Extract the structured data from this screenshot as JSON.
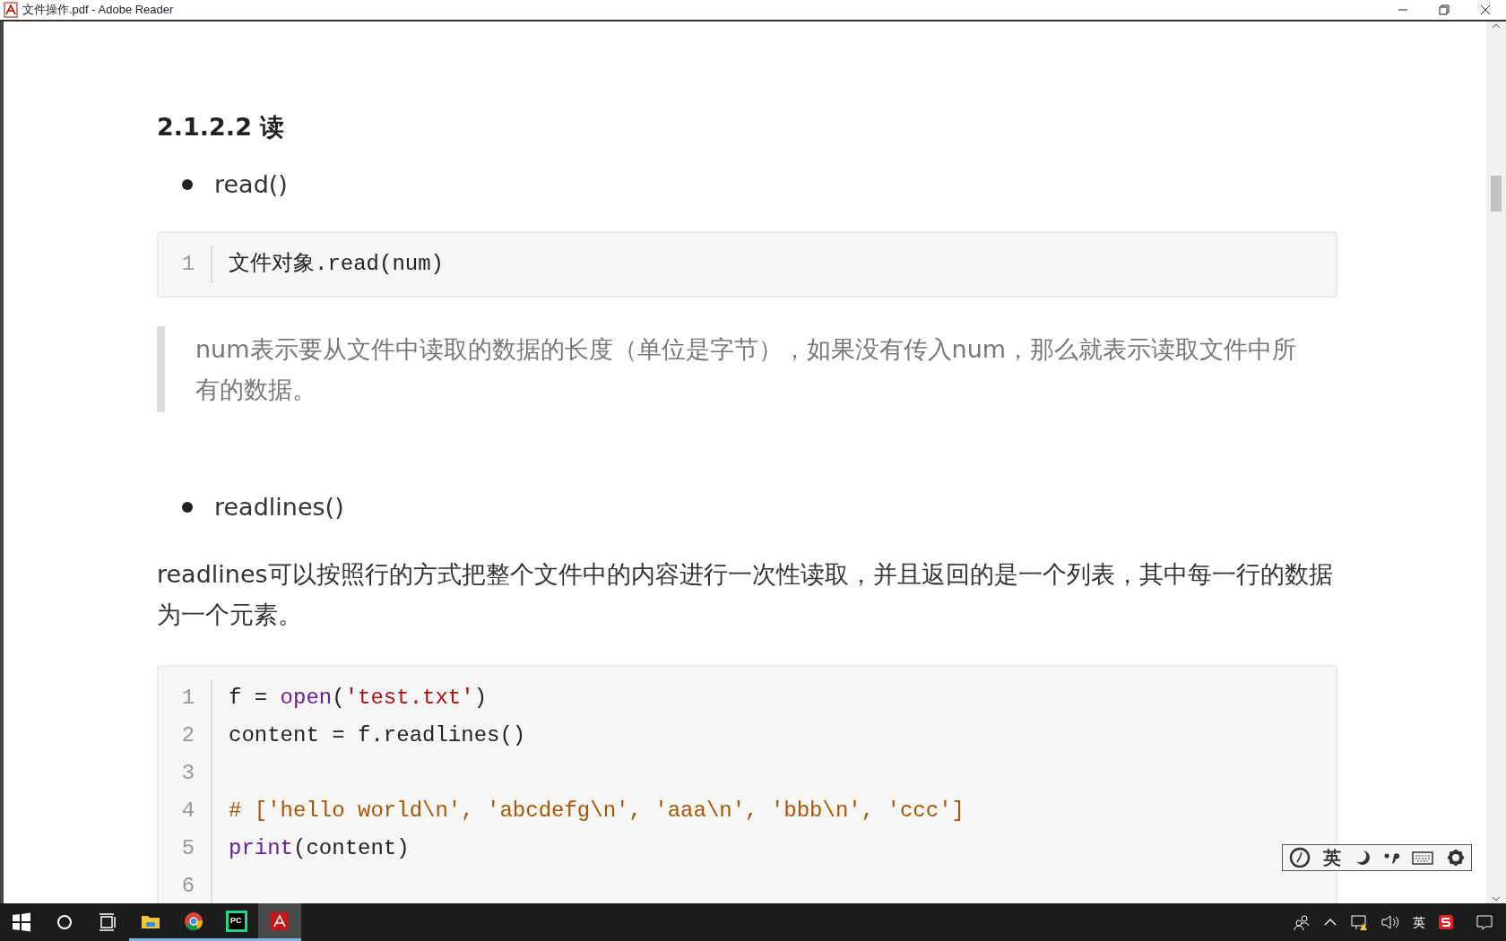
{
  "window": {
    "title": "文件操作.pdf - Adobe Reader"
  },
  "document": [
    {
      "kind": "heading",
      "text": "2.1.2.2 读"
    },
    {
      "kind": "bullet",
      "text": "read()"
    },
    {
      "kind": "code",
      "lines": [
        {
          "number": "1",
          "tokens": [
            {
              "kind": "plain",
              "text": "文件对象.read(num)"
            }
          ]
        }
      ]
    },
    {
      "kind": "quote",
      "text": "num表示要从文件中读取的数据的长度（单位是字节），如果没有传入num，那么就表示读取文件中所有的数据。"
    },
    {
      "kind": "bullet",
      "text": "readlines()"
    },
    {
      "kind": "paragraph",
      "text": "readlines可以按照行的方式把整个文件中的内容进行一次性读取，并且返回的是一个列表，其中每一行的数据为一个元素。"
    },
    {
      "kind": "code",
      "lines": [
        {
          "number": "1",
          "tokens": [
            {
              "kind": "plain",
              "text": "f = "
            },
            {
              "kind": "builtin",
              "text": "open"
            },
            {
              "kind": "plain",
              "text": "("
            },
            {
              "kind": "string",
              "text": "'test.txt'"
            },
            {
              "kind": "plain",
              "text": ")"
            }
          ]
        },
        {
          "number": "2",
          "tokens": [
            {
              "kind": "plain",
              "text": "content = f.readlines()"
            }
          ]
        },
        {
          "number": "3"
        },
        {
          "number": "4",
          "tokens": [
            {
              "kind": "comment",
              "text": "# ['hello world\\n', 'abcdefg\\n', 'aaa\\n', 'bbb\\n', 'ccc']"
            }
          ]
        },
        {
          "number": "5",
          "tokens": [
            {
              "kind": "builtin",
              "text": "print"
            },
            {
              "kind": "plain",
              "text": "(content)"
            }
          ]
        },
        {
          "number": "6"
        }
      ]
    }
  ],
  "ime_toolbar": {
    "mode": "英"
  },
  "taskbar": {
    "apps": [
      {
        "kind": "explorer",
        "selected": false
      },
      {
        "kind": "chrome",
        "selected": false
      },
      {
        "kind": "pycharm",
        "selected": false,
        "label": "PC"
      },
      {
        "kind": "acrobat",
        "selected": true
      }
    ],
    "input_language": "英"
  }
}
